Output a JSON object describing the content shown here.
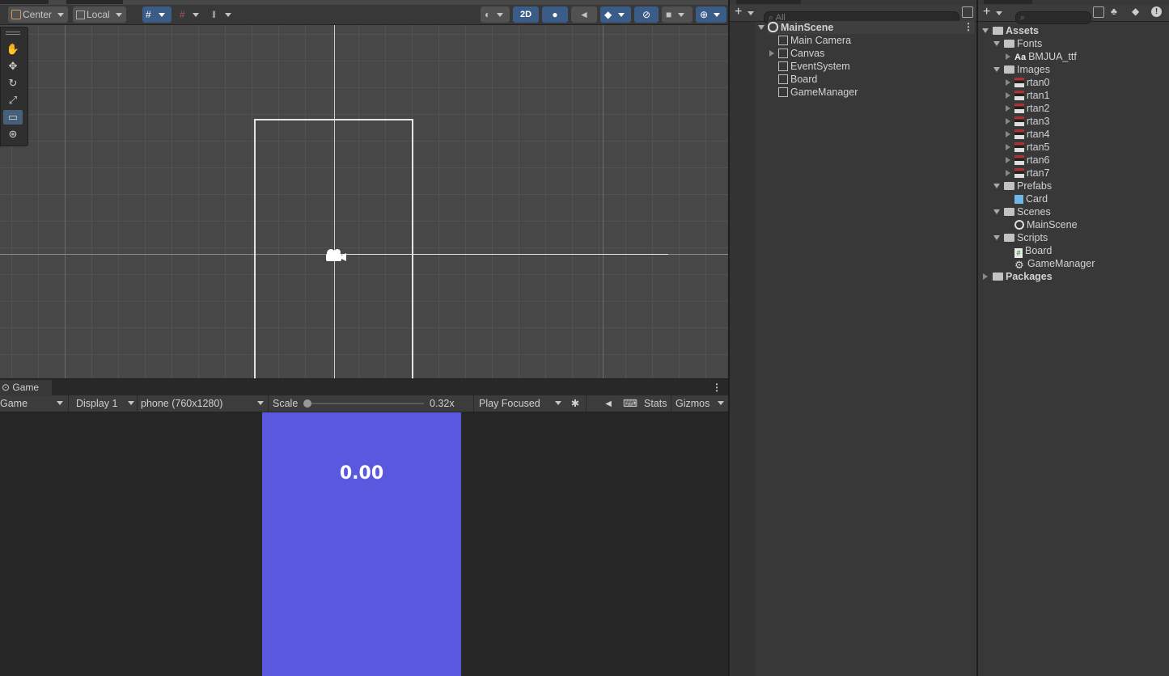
{
  "scene_toolbar": {
    "pivot_mode": "Center",
    "pivot_rotation": "Local",
    "mode_2d": "2D"
  },
  "tools": [
    "hand-tool",
    "move-tool",
    "rotate-tool",
    "scale-tool",
    "rect-tool",
    "transform-tool"
  ],
  "game": {
    "tab_label": "Game",
    "view_mode": "Game",
    "display": "Display 1",
    "resolution": "phone (760x1280)",
    "scale_label": "Scale",
    "scale_value": "0.32x",
    "scale_fraction": 0.0,
    "play_mode": "Play Focused",
    "stats": "Stats",
    "gizmos": "Gizmos",
    "timer_text": "0.00",
    "background_color": "#5b58e0"
  },
  "hierarchy": {
    "search_placeholder": "All",
    "scene": "MainScene",
    "items": [
      {
        "label": "Main Camera",
        "expandable": false
      },
      {
        "label": "Canvas",
        "expandable": true
      },
      {
        "label": "EventSystem",
        "expandable": false
      },
      {
        "label": "Board",
        "expandable": false
      },
      {
        "label": "GameManager",
        "expandable": false
      }
    ]
  },
  "project": {
    "assets": "Assets",
    "fonts": "Fonts",
    "font_file_prefix": "Aa",
    "font_file": "BMJUA_ttf",
    "images": "Images",
    "image_items": [
      "rtan0",
      "rtan1",
      "rtan2",
      "rtan3",
      "rtan4",
      "rtan5",
      "rtan6",
      "rtan7"
    ],
    "prefabs": "Prefabs",
    "card": "Card",
    "scenes": "Scenes",
    "main_scene": "MainScene",
    "scripts": "Scripts",
    "script_items": [
      "Board",
      "GameManager"
    ],
    "packages": "Packages"
  }
}
